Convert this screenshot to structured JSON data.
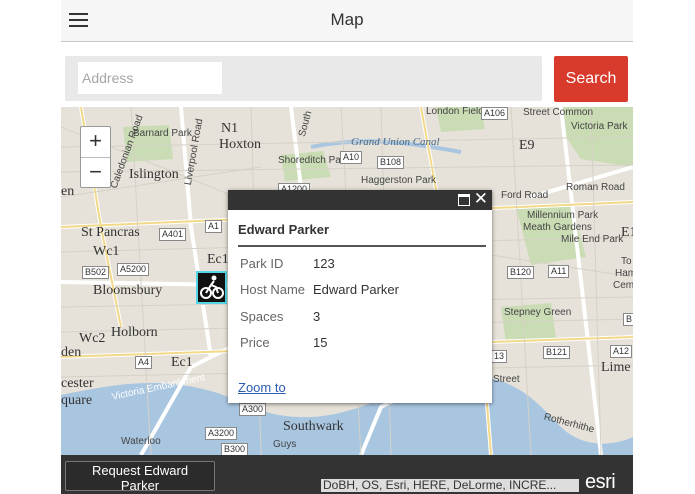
{
  "header": {
    "title": "Map",
    "menu_icon": "hamburger-menu-icon"
  },
  "search": {
    "placeholder": "Address",
    "value": "",
    "button_label": "Search"
  },
  "map": {
    "zoom_in_label": "+",
    "zoom_out_label": "−",
    "labels": {
      "barnard_park": "Barnard Park",
      "n1": "N1",
      "hoxton": "Hoxton",
      "islington": "Islington",
      "shoreditch_park": "Shoreditch Park",
      "grand_union_canal": "Grand Union Canal",
      "haggerston_park": "Haggerston Park",
      "london_fields": "London Fields",
      "victoria_park": "Victoria Park",
      "street_common": "Street Common",
      "e9": "E9",
      "roman_road": "Roman Road",
      "ford_road": "Ford Road",
      "millennium_park": "Millennium Park",
      "meath_gardens": "Meath Gardens",
      "mile_end_park": "Mile End Park",
      "st_pancras": "St Pancras",
      "wc1": "Wc1",
      "bloomsbury": "Bloomsbury",
      "holborn": "Holborn",
      "wc2": "Wc2",
      "ec1_a": "Ec1",
      "ec1_b": "Ec1",
      "ester": "cester",
      "quare": "quare",
      "victoria_embankment": "Victoria Embankment",
      "southwark": "Southwark",
      "waterloo": "Waterloo",
      "guys": "Guys",
      "rotherhithe": "Rotherhithe",
      "stepney_green": "Stepney Green",
      "street": "Street",
      "lime": "Lime",
      "den": "den",
      "e1": "E1",
      "to": "To",
      "ham": "Ham",
      "cem": "Cem",
      "en": "en",
      "donian_road": "Caledonian Road",
      "liverpool_rd": "Liverpool Road",
      "south": "South"
    },
    "roads": {
      "a106": "A106",
      "a10": "A10",
      "b108": "B108",
      "a1200": "A1200",
      "a401": "A401",
      "a1": "A1",
      "b502": "B502",
      "a5200": "A5200",
      "a4": "A4",
      "a300": "A300",
      "a3200": "A3200",
      "b300": "B300",
      "b120": "B120",
      "a11": "A11",
      "b121": "B121",
      "a12": "A12",
      "a13": "13",
      "b": "B"
    }
  },
  "popup": {
    "title": "Edward Parker",
    "fields": [
      {
        "label": "Park ID",
        "value": "123"
      },
      {
        "label": "Host Name",
        "value": "Edward Parker"
      },
      {
        "label": "Spaces",
        "value": "3"
      },
      {
        "label": "Price",
        "value": "15"
      }
    ],
    "zoom_link": "Zoom to"
  },
  "footer": {
    "request_button": "Request Edward Parker",
    "attribution": "DoBH, OS, Esri, HERE, DeLorme, INCRE...",
    "logo": "esri"
  },
  "colors": {
    "accent": "#d83a2c",
    "marker_outline": "#55d6e6",
    "water": "#a9c6e1",
    "park": "#c9dcb4"
  }
}
